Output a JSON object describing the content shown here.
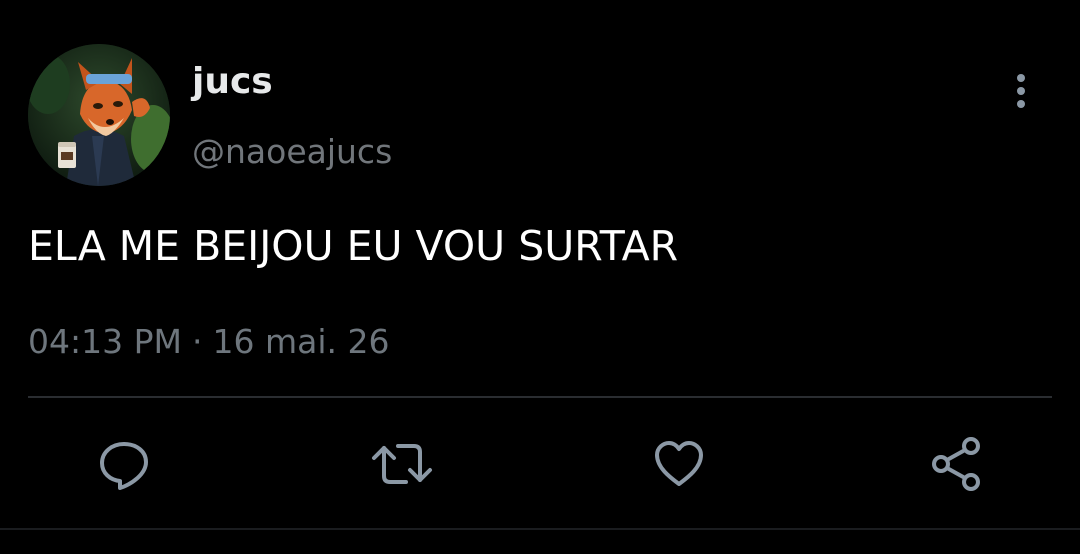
{
  "tweet": {
    "author": {
      "display_name": "jucs",
      "handle": "@naoeajucs",
      "avatar": "avatar-icon"
    },
    "text": "ELA ME BEIJOU EU VOU SURTAR",
    "time": "04:13 PM",
    "separator": "·",
    "date": "16 mai. 26"
  },
  "actions": [
    {
      "name": "reply",
      "icon": "reply-icon"
    },
    {
      "name": "retweet",
      "icon": "retweet-icon"
    },
    {
      "name": "like",
      "icon": "heart-icon"
    },
    {
      "name": "share",
      "icon": "share-icon"
    }
  ],
  "menu": {
    "icon": "more-vertical-icon"
  },
  "colors": {
    "background": "#000000",
    "primary_text": "#e7e9ea",
    "secondary_text": "#71767b",
    "icon": "#8b98a5",
    "divider": "#2a2d31"
  }
}
